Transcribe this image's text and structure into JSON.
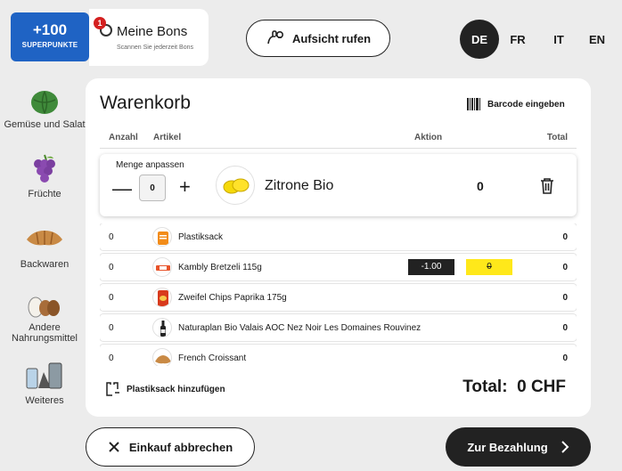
{
  "promo": {
    "points": "+100",
    "label": "SUPERPUNKTE"
  },
  "bons": {
    "badge": "1",
    "title": "Meine Bons",
    "subtitle": "Scannen Sie jederzeit Bons"
  },
  "supervisor_button": {
    "label": "Aufsicht rufen",
    "icon": "hand-icon"
  },
  "languages": [
    {
      "code": "DE",
      "active": true
    },
    {
      "code": "FR",
      "active": false
    },
    {
      "code": "IT",
      "active": false
    },
    {
      "code": "EN",
      "active": false
    }
  ],
  "sidebar": {
    "items": [
      {
        "label": "Gemüse und Salat",
        "icon": "cabbage-icon"
      },
      {
        "label": "Früchte",
        "icon": "grapes-icon"
      },
      {
        "label": "Backwaren",
        "icon": "croissant-icon"
      },
      {
        "label": "Andere Nahrungsmittel",
        "icon": "eggs-icon"
      },
      {
        "label": "Weiteres",
        "icon": "household-icon"
      }
    ]
  },
  "cart": {
    "title": "Warenkorb",
    "barcode_label": "Barcode eingeben",
    "columns": {
      "qty": "Anzahl",
      "article": "Artikel",
      "action": "Aktion",
      "total": "Total"
    },
    "editing": {
      "label": "Menge anpassen",
      "quantity": "0",
      "product": "Zitrone Bio",
      "total": "0"
    },
    "items": [
      {
        "qty": "0",
        "name": "Plastiksack",
        "total": "0"
      },
      {
        "qty": "0",
        "name": "Kambly Bretzeli 115g",
        "total": "0",
        "discount": "-1.00",
        "struck_price": "0"
      },
      {
        "qty": "0",
        "name": "Zweifel Chips Paprika 175g",
        "total": "0"
      },
      {
        "qty": "0",
        "name": "Naturaplan Bio Valais AOC Nez Noir Les Domaines Rouvinez",
        "total": "0"
      },
      {
        "qty": "0",
        "name": "French Croissant",
        "total": "0"
      }
    ],
    "add_bag": "Plastiksack hinzufügen",
    "grand_total": "Total:  0 CHF"
  },
  "footer": {
    "cancel": "Einkauf abbrechen",
    "pay": "Zur Bezahlung"
  },
  "colors": {
    "promo_blue": "#1f63c4",
    "dark": "#222222",
    "highlight_yellow": "#ffe81a",
    "badge_red": "#d42020"
  }
}
